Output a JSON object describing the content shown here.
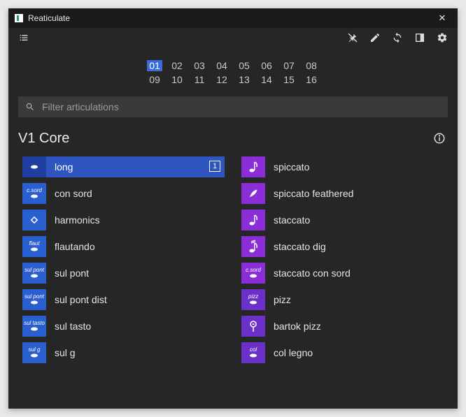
{
  "window": {
    "title": "Reaticulate"
  },
  "channels": {
    "row1": [
      "01",
      "02",
      "03",
      "04",
      "05",
      "06",
      "07",
      "08"
    ],
    "row2": [
      "09",
      "10",
      "11",
      "12",
      "13",
      "14",
      "15",
      "16"
    ],
    "active": "01"
  },
  "filter": {
    "placeholder": "Filter articulations"
  },
  "section": {
    "title": "V1 Core"
  },
  "left": [
    {
      "label": "long",
      "tag": "",
      "selected": true,
      "badge": "1",
      "icon": "note"
    },
    {
      "label": "con sord",
      "tag": "c.sord",
      "icon": "note"
    },
    {
      "label": "harmonics",
      "tag": "",
      "icon": "diamond"
    },
    {
      "label": "flautando",
      "tag": "flaut",
      "icon": "note"
    },
    {
      "label": "sul pont",
      "tag": "sul pont",
      "icon": "note"
    },
    {
      "label": "sul pont dist",
      "tag": "sul pont",
      "icon": "note"
    },
    {
      "label": "sul tasto",
      "tag": "sul tasto",
      "icon": "note"
    },
    {
      "label": "sul g",
      "tag": "sul g",
      "icon": "note"
    }
  ],
  "right": [
    {
      "label": "spiccato",
      "tag": "",
      "color": "purple",
      "icon": "eighth"
    },
    {
      "label": "spiccato feathered",
      "tag": "",
      "color": "purple",
      "icon": "feather"
    },
    {
      "label": "staccato",
      "tag": "",
      "color": "purple",
      "icon": "eighth"
    },
    {
      "label": "staccato dig",
      "tag": "",
      "color": "purple",
      "icon": "eighth-acc"
    },
    {
      "label": "staccato con sord",
      "tag": "c.sord",
      "color": "purple",
      "icon": "note"
    },
    {
      "label": "pizz",
      "tag": "pizz",
      "color": "violet",
      "icon": "note"
    },
    {
      "label": "bartok pizz",
      "tag": "",
      "color": "violet",
      "icon": "bartok"
    },
    {
      "label": "col legno",
      "tag": "col",
      "color": "violet",
      "icon": "note"
    }
  ]
}
